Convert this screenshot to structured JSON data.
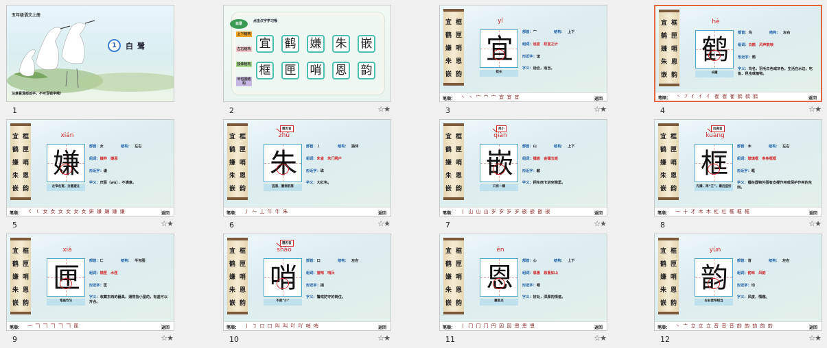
{
  "slides": [
    {
      "number": "1",
      "star": "",
      "type": "cover",
      "top_title": "五年级语文上册",
      "lesson_no": "1",
      "lesson_title": "白鹭",
      "note": "注意看清部首字，不可写错字哦！"
    },
    {
      "number": "2",
      "star": "☆★",
      "type": "index",
      "heading": "点击汉字学习哦",
      "leaf_label": "目录",
      "labels": [
        "上下结构",
        "左右结构",
        "独体结构",
        "半包围结构"
      ],
      "chars_row1": [
        "宜",
        "鹤",
        "嫌",
        "朱",
        "嵌"
      ],
      "chars_row2": [
        "框",
        "匣",
        "哨",
        "恩",
        "韵"
      ]
    },
    {
      "number": "3",
      "star": "☆★",
      "type": "card",
      "scroll_chars": [
        "宜",
        "鹤",
        "嫌",
        "朱",
        "嵌",
        "框",
        "匣",
        "哨",
        "恩",
        "韵"
      ],
      "pinyin": "yí",
      "char": "宜",
      "tip": "捺长",
      "radical_label": "部首：",
      "radical": "宀",
      "struct_label": "结构：",
      "struct": "上下",
      "words_label": "组词：",
      "words": "适宜　权宜之计",
      "similar_label": "形近字：",
      "similar": "谊",
      "meaning_label": "字义：",
      "meaning": "适合，适当。",
      "strokes_label": "笔顺：",
      "strokes": "丶 丶 宀 宀 宀 宜 宜 宜",
      "return_label": "返回"
    },
    {
      "number": "4",
      "star": "☆★",
      "type": "card",
      "scroll_chars": [
        "宜",
        "鹤",
        "嫌",
        "朱",
        "嵌",
        "框",
        "匣",
        "哨",
        "恩",
        "韵"
      ],
      "pinyin": "hè",
      "char": "鹤",
      "tip": "长撇",
      "radical_label": "部首：",
      "radical": "鸟",
      "struct_label": "结构：",
      "struct": "左右",
      "words_label": "组词：",
      "words": "白鹤　风声鹤唳",
      "similar_label": "形近字：",
      "similar": "鹄",
      "meaning_label": "字义：",
      "meaning": "鸟名，羽毛白色或灰色，生活在水边，吃鱼、昆虫或植物。",
      "strokes_label": "笔顺：",
      "strokes": "丶 ㇇ 亻 亻 亻 隺 隺 隺 鹤 鹤 鹤",
      "return_label": "返回"
    },
    {
      "number": "5",
      "star": "☆★",
      "type": "card",
      "scroll_chars": [
        "宜",
        "鹤",
        "嫌",
        "朱",
        "嵌",
        "框",
        "匣",
        "哨",
        "恩",
        "韵"
      ],
      "pinyin": "xián",
      "char": "嫌",
      "tip": "左窄右宽，注意避让",
      "radical_label": "部首：",
      "radical": "女",
      "struct_label": "结构：",
      "struct": "左右",
      "words_label": "组词：",
      "words": "嫌弃　嫌恶",
      "similar_label": "形近字：",
      "similar": "谦",
      "meaning_label": "字义：",
      "meaning": "厌恶（wù），不满意。",
      "strokes_label": "笔顺：",
      "strokes": "㇛ 𡿨 女 女 女 女 女 女 姘 嫌 嫌 嫌 嫌",
      "return_label": "返回"
    },
    {
      "number": "6",
      "star": "☆★",
      "type": "card",
      "scroll_chars": [
        "宜",
        "鹤",
        "嫌",
        "朱",
        "嵌",
        "框",
        "匣",
        "哨",
        "恩",
        "韵"
      ],
      "pinyin": "zhū",
      "char": "朱",
      "tip": "竖直，撇捺舒展",
      "hint": "翘舌音",
      "radical_label": "部首：",
      "radical": "丿",
      "struct_label": "结构：",
      "struct": "独体",
      "words_label": "组词：",
      "words": "朱雀　朱门绣户",
      "similar_label": "形近字：",
      "similar": "珠",
      "meaning_label": "字义：",
      "meaning": "大红色。",
      "strokes_label": "笔顺：",
      "strokes": "丿 𠂉 丄 牛 牛 朱",
      "return_label": "返回"
    },
    {
      "number": "7",
      "star": "☆★",
      "type": "card",
      "scroll_chars": [
        "宜",
        "鹤",
        "嫌",
        "朱",
        "嵌",
        "框",
        "匣",
        "哨",
        "恩",
        "韵"
      ],
      "pinyin": "qiàn",
      "char": "嵌",
      "tip": "只有一横",
      "hint": "再小",
      "radical_label": "部首：",
      "radical": "山",
      "struct_label": "结构：",
      "struct": "上下",
      "words_label": "组词：",
      "words": "镶嵌　金镶玉嵌",
      "similar_label": "形近字：",
      "similar": "歉",
      "meaning_label": "字义：",
      "meaning": "把东西卡进空隙里。",
      "strokes_label": "笔顺：",
      "strokes": "丨 山 山 山 岁 岁 岁 岁 嵌 嵌 嵌 嵌",
      "return_label": "返回"
    },
    {
      "number": "8",
      "star": "☆★",
      "type": "card",
      "scroll_chars": [
        "宜",
        "鹤",
        "嫌",
        "朱",
        "嵌",
        "框",
        "匣",
        "哨",
        "恩",
        "韵"
      ],
      "pinyin": "kuàng",
      "char": "框",
      "tip": "先横，再“王”，最后竖折",
      "hint": "后鼻音",
      "radical_label": "部首：",
      "radical": "木",
      "struct_label": "结构：",
      "struct": "左右",
      "words_label": "组词：",
      "words": "玻璃框　条条框框",
      "similar_label": "形近字：",
      "similar": "眶",
      "meaning_label": "字义：",
      "meaning": "镶在器物外围有支撑作用或保护作用的东西。",
      "strokes_label": "笔顺：",
      "strokes": "一 十 才 木 木 杠 杠 框 框 框",
      "return_label": "返回"
    },
    {
      "number": "9",
      "star": "☆★",
      "type": "card",
      "scroll_chars": [
        "宜",
        "鹤",
        "嫌",
        "朱",
        "嵌",
        "框",
        "匣",
        "哨",
        "恩",
        "韵"
      ],
      "pinyin": "xiá",
      "char": "匣",
      "tip": "笔画均匀",
      "radical_label": "部首：",
      "radical": "匚",
      "struct_label": "结构：",
      "struct": "半包围",
      "words_label": "组词：",
      "words": "镜匣　木匣",
      "similar_label": "形近字：",
      "similar": "匡",
      "meaning_label": "字义：",
      "meaning": "收藏东西的器具，通常指小型的，有盖可以开合。",
      "strokes_label": "笔顺：",
      "strokes": "一 𠃍 𠃍 𠃍 𠃍 𠃍 匣",
      "return_label": "返回"
    },
    {
      "number": "10",
      "star": "☆★",
      "type": "card",
      "scroll_chars": [
        "宜",
        "鹤",
        "嫌",
        "朱",
        "嵌",
        "框",
        "匣",
        "哨",
        "恩",
        "韵"
      ],
      "pinyin": "shào",
      "char": "哨",
      "tip": "不是“小”",
      "hint": "翘舌音",
      "radical_label": "部首：",
      "radical": "口",
      "struct_label": "结构：",
      "struct": "左右",
      "words_label": "组词：",
      "words": "望哨　哨兵",
      "similar_label": "形近字：",
      "similar": "捎",
      "meaning_label": "字义：",
      "meaning": "警戒防守的岗位。",
      "strokes_label": "笔顺：",
      "strokes": "丨 ㇆ 口 口 叫 叫 吖 吖 哨 哨",
      "return_label": "返回"
    },
    {
      "number": "11",
      "star": "☆★",
      "type": "card",
      "scroll_chars": [
        "宜",
        "鹤",
        "嫌",
        "朱",
        "嵌",
        "框",
        "匣",
        "哨",
        "恩",
        "韵"
      ],
      "pinyin": "ēn",
      "char": "恩",
      "tip": "撇变点",
      "radical_label": "部首：",
      "radical": "心",
      "struct_label": "结构：",
      "struct": "上下",
      "words_label": "组词：",
      "words": "恩惠　恩重如山",
      "similar_label": "形近字：",
      "similar": "嗯",
      "meaning_label": "字义：",
      "meaning": "好处，深厚的情谊。",
      "strokes_label": "笔顺：",
      "strokes": "丨 冂 冂 冂 円 因 因 恩 恩 恩",
      "return_label": "返回"
    },
    {
      "number": "12",
      "star": "☆★",
      "type": "card",
      "scroll_chars": [
        "宜",
        "鹤",
        "嫌",
        "朱",
        "嵌",
        "框",
        "匣",
        "哨",
        "恩",
        "韵"
      ],
      "pinyin": "yùn",
      "char": "韵",
      "tip": "左右宽窄相当",
      "radical_label": "部首：",
      "radical": "音",
      "struct_label": "结构：",
      "struct": "左右",
      "words_label": "组词：",
      "words": "韵味　风韵",
      "similar_label": "形近字：",
      "similar": "均",
      "meaning_label": "字义：",
      "meaning": "风度，情趣。",
      "strokes_label": "笔顺：",
      "strokes": "丶 亠 立 立 立 音 音 音 韵 韵 韵 韵 韵",
      "return_label": "返回"
    }
  ],
  "selected": "4",
  "colors": {
    "accent_selected": "#e4643d",
    "pinyin_red": "#d0262a",
    "label_blue": "#1c5fa8"
  }
}
